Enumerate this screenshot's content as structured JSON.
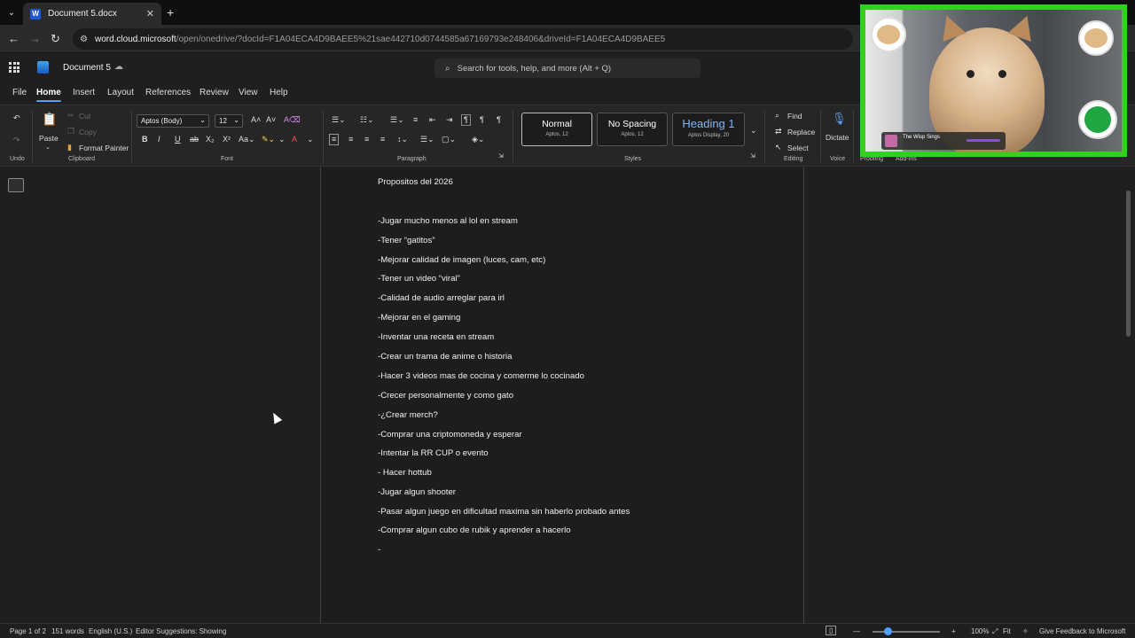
{
  "browser": {
    "tab_title": "Document 5.docx",
    "url_prefix": "word.cloud.microsoft",
    "url_rest": "/open/onedrive/?docId=F1A04ECA4D9BAEE5%21sae442710d0744585a67169793e248406&driveId=F1A04ECA4D9BAEE5"
  },
  "app": {
    "doc_name": "Document 5",
    "search_placeholder": "Search for tools, help, and more (Alt + Q)"
  },
  "menu": [
    "File",
    "Home",
    "Insert",
    "Layout",
    "References",
    "Review",
    "View",
    "Help"
  ],
  "ribbon": {
    "undo": "Undo",
    "paste": "Paste",
    "cut": "Cut",
    "copy": "Copy",
    "format_painter": "Format Painter",
    "clipboard": "Clipboard",
    "font_name": "Aptos (Body)",
    "font_size": "12",
    "font": "Font",
    "paragraph": "Paragraph",
    "styles_label": "Styles",
    "styles": [
      {
        "name": "Normal",
        "sub": "Aptos, 12"
      },
      {
        "name": "No Spacing",
        "sub": "Aptos, 12"
      },
      {
        "name": "Heading 1",
        "sub": "Aptos Display, 20"
      }
    ],
    "find": "Find",
    "replace": "Replace",
    "select": "Select",
    "editing": "Editing",
    "dictate": "Dictate",
    "voice": "Voice",
    "proofing": "Proofing",
    "addins": "Add-ins"
  },
  "document": {
    "lines": [
      "Propositos del 2026",
      "-Jugar mucho menos al lol en stream",
      "-Tener “gatitos”",
      "-Mejorar calidad de imagen (luces, cam, etc)",
      "-Tener un video “viral”",
      "-Calidad de audio arreglar para irl",
      "-Mejorar en el gaming",
      "-Inventar una receta en stream",
      "-Crear un trama de anime o historia",
      "-Hacer 3 videos mas de cocina y comerme lo cocinado",
      "-Crecer personalmente y como gato",
      "-¿Crear merch?",
      "-Comprar una criptomoneda y esperar",
      "-Intentar la RR CUP o evento",
      "- Hacer hottub",
      "-Jugar algun shooter",
      "-Pasar algun juego en dificultad maxima sin haberlo probado antes",
      "-Comprar algun cubo de rubik y aprender a hacerlo",
      "-"
    ]
  },
  "status": {
    "page": "Page 1 of 2",
    "words": "151 words",
    "language": "English (U.S.)",
    "editor": "Editor Suggestions: Showing",
    "zoom": "100%",
    "fit": "Fit",
    "feedback": "Give Feedback to Microsoft"
  },
  "webcam": {
    "song_title": "The Wisp Sings"
  }
}
